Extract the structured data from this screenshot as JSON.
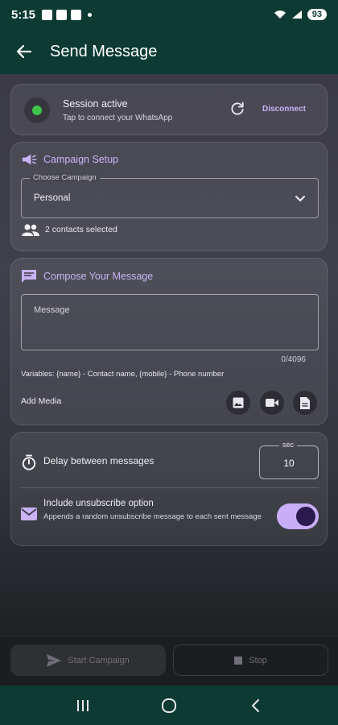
{
  "status_bar": {
    "time": "5:15",
    "battery": "93"
  },
  "app_bar": {
    "title": "Send Message"
  },
  "session": {
    "title": "Session active",
    "subtitle": "Tap to connect your WhatsApp",
    "disconnect_label": "Disconnect",
    "status_color": "#3ec44a"
  },
  "campaign": {
    "header": "Campaign Setup",
    "select_label": "Choose Campaign",
    "selected_value": "Personal",
    "contacts_label": "2 contacts selected"
  },
  "compose": {
    "header": "Compose Your Message",
    "message_placeholder": "Message",
    "char_count": "0/4096",
    "variables_text": "Variables: {name} - Contact name, {mobile} - Phone number",
    "add_media_label": "Add Media"
  },
  "settings": {
    "delay_label": "Delay between messages",
    "delay_unit": "sec",
    "delay_value": "10",
    "unsubscribe_title": "Include unsubscribe option",
    "unsubscribe_desc": "Appends a random unsubscribe message to each sent message",
    "unsubscribe_enabled": true
  },
  "actions": {
    "start_label": "Start Campaign",
    "stop_label": "Stop"
  },
  "colors": {
    "accent": "#c9b3f5",
    "app_bar": "#0d3b33"
  }
}
